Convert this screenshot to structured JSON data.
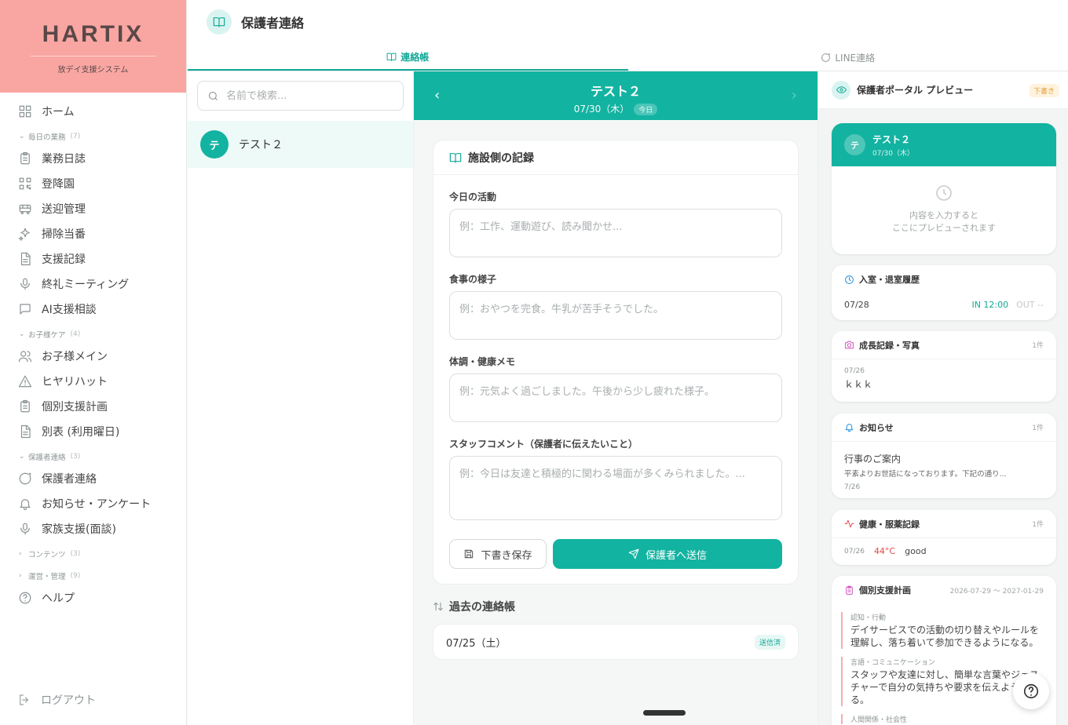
{
  "brand": {
    "logo": "HARTIX",
    "subtitle": "放デイ支援システム"
  },
  "sidebar": {
    "home": "ホーム",
    "sections": [
      {
        "label": "毎日の業務",
        "count": "(7)",
        "items": [
          "業務日誌",
          "登降園",
          "送迎管理",
          "掃除当番",
          "支援記録",
          "終礼ミーティング",
          "AI支援相談"
        ]
      },
      {
        "label": "お子様ケア",
        "count": "(4)",
        "items": [
          "お子様メイン",
          "ヒヤリハット",
          "個別支援計画",
          "別表 (利用曜日)"
        ]
      },
      {
        "label": "保護者連絡",
        "count": "(3)",
        "items": [
          "保護者連絡",
          "お知らせ・アンケート",
          "家族支援(面談)"
        ]
      },
      {
        "label": "コンテンツ",
        "count": "(3)"
      },
      {
        "label": "運営・管理",
        "count": "(9)"
      }
    ],
    "help": "ヘルプ",
    "logout": "ログアウト"
  },
  "header": {
    "title": "保護者連絡",
    "tabs": [
      {
        "label": "連絡帳"
      },
      {
        "label": "LINE連絡"
      }
    ]
  },
  "list": {
    "search_placeholder": "名前で検索...",
    "children": [
      {
        "initial": "テ",
        "name": "テスト２"
      }
    ]
  },
  "day": {
    "name": "テスト２",
    "date": "07/30（木）",
    "today": "今日"
  },
  "record": {
    "title": "施設側の記録",
    "fields": [
      {
        "label": "今日の活動",
        "placeholder": "例：工作、運動遊び、読み聞かせ..."
      },
      {
        "label": "食事の様子",
        "placeholder": "例：おやつを完食。牛乳が苦手そうでした。"
      },
      {
        "label": "体調・健康メモ",
        "placeholder": "例：元気よく過ごしました。午後から少し疲れた様子。"
      },
      {
        "label": "スタッフコメント（保護者に伝えたいこと）",
        "placeholder": "例：今日は友達と積極的に関わる場面が多くみられました。..."
      }
    ],
    "draft_label": "下書き保存",
    "send_label": "保護者へ送信"
  },
  "past": {
    "title": "過去の連絡帳",
    "items": [
      {
        "date": "07/25（土）",
        "status": "送信済"
      }
    ]
  },
  "preview": {
    "title": "保護者ポータル プレビュー",
    "draft_badge": "下書き",
    "card": {
      "initial": "テ",
      "name": "テスト２",
      "date": "07/30（木）",
      "empty_line1": "内容を入力すると",
      "empty_line2": "ここにプレビューされます"
    },
    "attendance": {
      "title": "入室・退室履歴",
      "date": "07/28",
      "in": "IN 12:00",
      "out": "OUT --"
    },
    "growth": {
      "title": "成長記録・写真",
      "count": "1件",
      "date": "07/26",
      "text": "ｋｋｋ"
    },
    "notice": {
      "title": "お知らせ",
      "count": "1件",
      "heading": "行事のご案内",
      "body": "平素よりお世話になっております。下記の通り...",
      "date": "7/26"
    },
    "health": {
      "title": "健康・服薬記録",
      "count": "1件",
      "date": "07/26",
      "temp": "44°C",
      "note": "good"
    },
    "plan": {
      "title": "個別支援計画",
      "period": "2026-07-29 〜 2027-01-29",
      "goals": [
        {
          "category": "認知・行動",
          "text": "デイサービスでの活動の切り替えやルールを理解し、落ち着いて参加できるようになる。"
        },
        {
          "category": "言語・コミュニケーション",
          "text": "スタッフや友達に対し、簡単な言葉やジェスチャーで自分の気持ちや要求を伝えようとする。"
        },
        {
          "category": "人間関係・社会性",
          "text": ""
        }
      ]
    }
  },
  "colors": {
    "accent": "#13b3a1",
    "brand": "#f9a6a2",
    "warn_temp": "#e04848"
  }
}
